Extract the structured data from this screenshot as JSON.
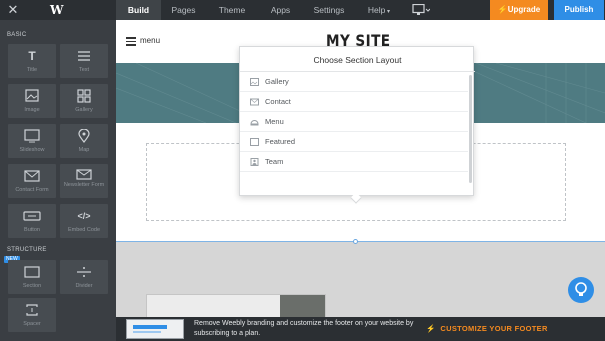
{
  "topbar": {
    "close_icon": "close-icon",
    "logo_letter": "W",
    "tabs": [
      "Build",
      "Pages",
      "Theme",
      "Apps",
      "Settings",
      "Help"
    ],
    "active_tab": "Build",
    "device_icon": "desktop-icon",
    "upgrade_label": "Upgrade",
    "publish_label": "Publish",
    "upgrade_color": "#f48a20",
    "publish_color": "#2f8ee6"
  },
  "sidebar": {
    "basic_label": "BASIC",
    "structure_label": "STRUCTURE",
    "new_badge": "NEW",
    "basic_items": [
      {
        "label": "Title",
        "icon": "title-icon"
      },
      {
        "label": "Text",
        "icon": "text-icon"
      },
      {
        "label": "Image",
        "icon": "image-icon"
      },
      {
        "label": "Gallery",
        "icon": "gallery-icon"
      },
      {
        "label": "Slideshow",
        "icon": "slideshow-icon"
      },
      {
        "label": "Map",
        "icon": "map-pin-icon"
      },
      {
        "label": "Contact Form",
        "icon": "envelope-icon"
      },
      {
        "label": "Newsletter Form",
        "icon": "newsletter-icon"
      },
      {
        "label": "Button",
        "icon": "button-icon"
      },
      {
        "label": "Embed Code",
        "icon": "code-icon"
      }
    ],
    "structure_items": [
      {
        "label": "Section",
        "icon": "section-icon"
      },
      {
        "label": "Divider",
        "icon": "divider-icon"
      },
      {
        "label": "Spacer",
        "icon": "spacer-icon"
      }
    ]
  },
  "site": {
    "menu_label": "menu",
    "title": "MY SITE"
  },
  "dropdown": {
    "title": "Choose Section Layout",
    "items": [
      {
        "label": "Gallery",
        "icon": "gallery-icon"
      },
      {
        "label": "Contact",
        "icon": "envelope-icon"
      },
      {
        "label": "Menu",
        "icon": "menu-cloche-icon"
      },
      {
        "label": "Featured",
        "icon": "featured-icon"
      },
      {
        "label": "Team",
        "icon": "team-icon"
      }
    ]
  },
  "bottombar": {
    "promo_text": "Remove Weebly branding and customize the footer on your website by subscribing to a plan.",
    "customize_label": "CUSTOMIZE YOUR FOOTER",
    "customize_icon": "lightning-icon"
  },
  "help_icon": "lightbulb-icon"
}
